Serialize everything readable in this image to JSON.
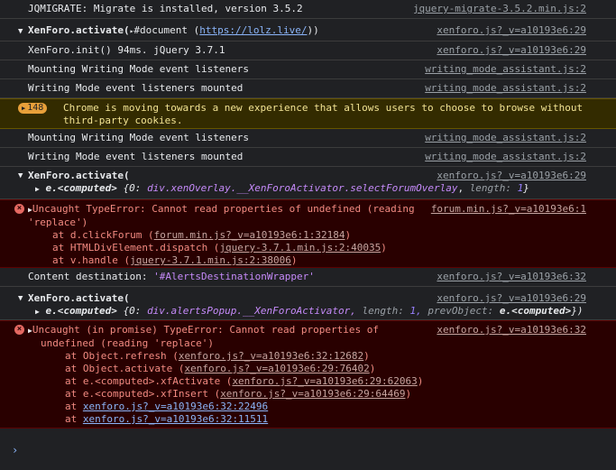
{
  "messages": [
    {
      "text": "JQMIGRATE: Migrate is installed, version 3.5.2",
      "source": "jquery-migrate-3.5.2.min.js:2"
    },
    {
      "prefix": "XenForo.activate(",
      "selector_icon": "▸",
      "arg": "#document",
      "url": "https://lolz.live/",
      "suffix": ")",
      "source": "xenforo.js?_v=a10193e6:29"
    },
    {
      "text": "XenForo.init() 94ms. jQuery 3.7.1",
      "source": "xenforo.js?_v=a10193e6:29"
    },
    {
      "text": "Mounting Writing Mode event listeners",
      "source": "writing_mode_assistant.js:2"
    },
    {
      "text": "Writing Mode event listeners mounted",
      "source": "writing_mode_assistant.js:2"
    },
    {
      "badge": "148",
      "text": "Chrome is moving towards a new experience that allows users to choose to browse without third-party cookies."
    },
    {
      "text": "Mounting Writing Mode event listeners",
      "source": "writing_mode_assistant.js:2"
    },
    {
      "text": "Writing Mode event listeners mounted",
      "source": "writing_mode_assistant.js:2"
    },
    {
      "title": "XenForo.activate(",
      "source": "xenforo.js?_v=a10193e6:29",
      "obj_prefix": "e.<computed>",
      "obj_open": "{0:",
      "obj_cls": "div.xenOverlay.__XenForoActivator.selectForumOverlay",
      "obj_len_key": "length:",
      "obj_len": "1",
      "obj_close": "}"
    },
    {
      "error": "Uncaught TypeError: Cannot read properties of undefined (reading 'replace')",
      "source": "forum.min.js?_v=a10193e6:1",
      "stack": [
        {
          "at": "at d.clickForum (",
          "link": "forum.min.js?_v=a10193e6:1:32184",
          "end": ")"
        },
        {
          "at": "at HTMLDivElement.dispatch (",
          "link": "jquery-3.7.1.min.js:2:40035",
          "end": ")"
        },
        {
          "at": "at v.handle (",
          "link": "jquery-3.7.1.min.js:2:38006",
          "end": ")"
        }
      ]
    },
    {
      "text": "Content destination: ",
      "str": "'#AlertsDestinationWrapper'",
      "source": "xenforo.js?_v=a10193e6:32"
    },
    {
      "title": "XenForo.activate(",
      "source": "xenforo.js?_v=a10193e6:29",
      "obj_prefix": "e.<computed>",
      "obj_open": "{0:",
      "obj_cls": "div.alertsPopup.__XenForoActivator,",
      "obj_len_key": "length:",
      "obj_len": "1,",
      "obj_prev_key": "prevObject:",
      "obj_prev": "e.<computed>",
      "obj_close": "})"
    },
    {
      "error": "Uncaught (in promise) TypeError: Cannot read properties of undefined (reading 'replace')",
      "source": "xenforo.js?_v=a10193e6:32",
      "stack": [
        {
          "at": "at Object.refresh (",
          "link": "xenforo.js?_v=a10193e6:32:12682",
          "end": ")"
        },
        {
          "at": "at Object.activate (",
          "link": "xenforo.js?_v=a10193e6:29:76402",
          "end": ")"
        },
        {
          "at": "at e.<computed>.xfActivate (",
          "link": "xenforo.js?_v=a10193e6:29:62063",
          "end": ")"
        },
        {
          "at": "at e.<computed>.xfInsert (",
          "link": "xenforo.js?_v=a10193e6:29:64469",
          "end": ")"
        },
        {
          "at": "at ",
          "link": "xenforo.js?_v=a10193e6:32:22496",
          "end": ""
        },
        {
          "at": "at ",
          "link": "xenforo.js?_v=a10193e6:32:11511",
          "end": ""
        }
      ]
    }
  ],
  "prompt": "›"
}
